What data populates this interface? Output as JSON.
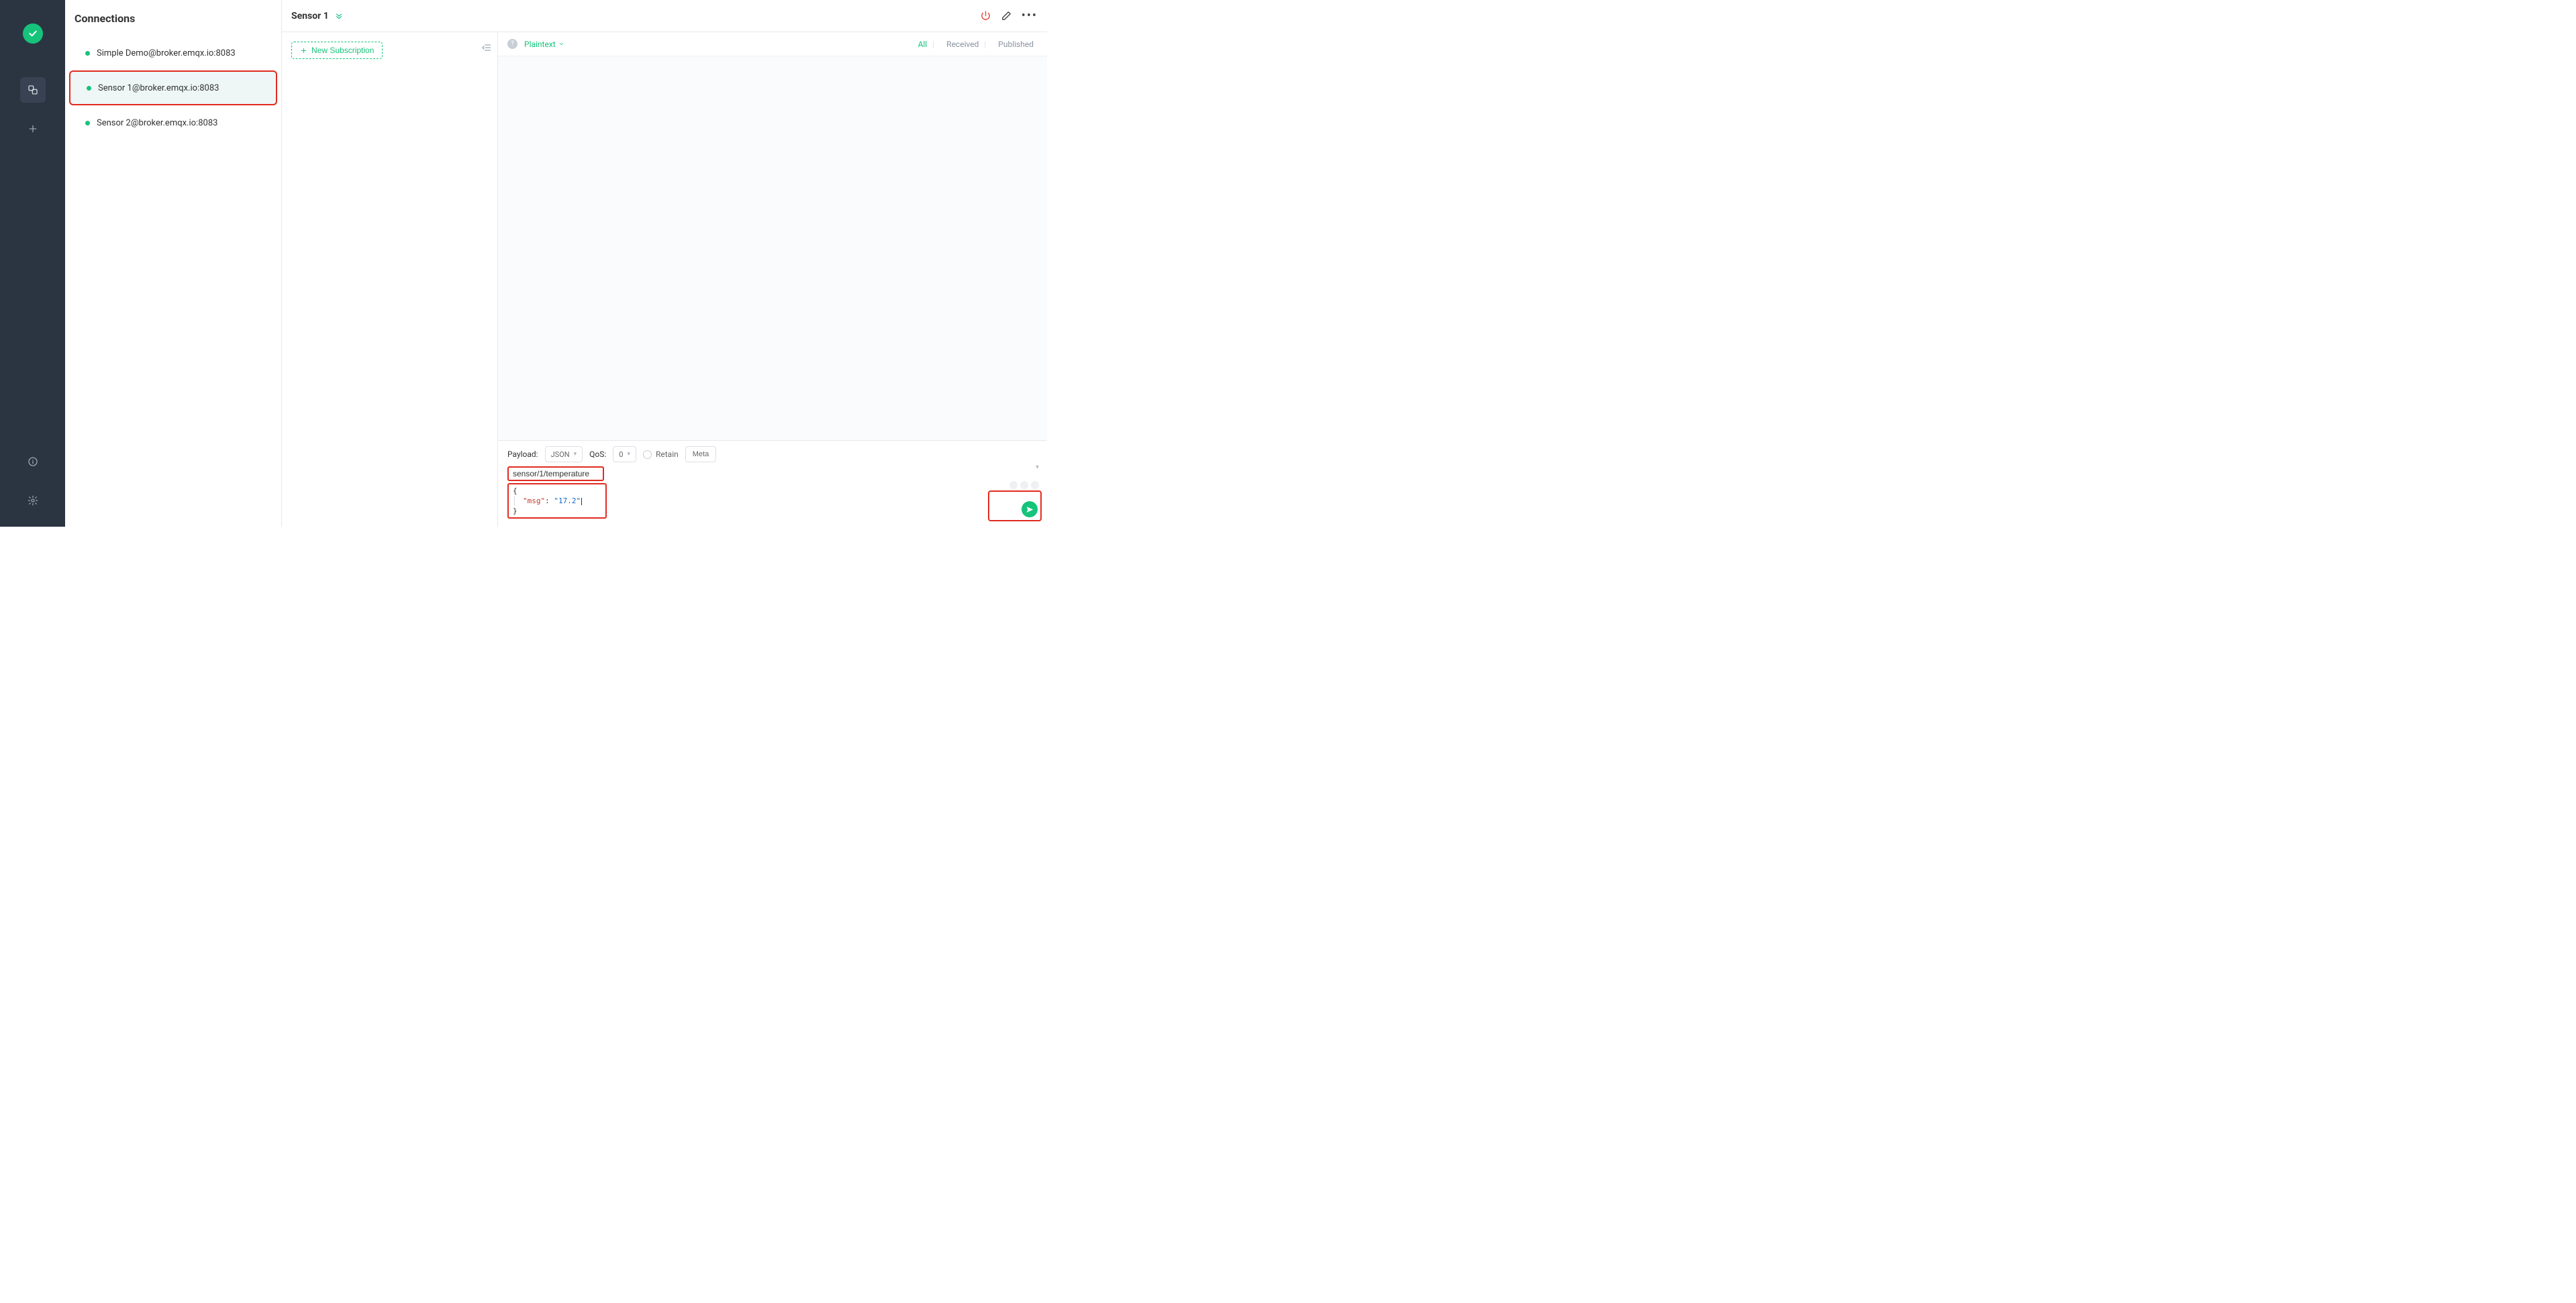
{
  "rail": {
    "items": [
      "connections",
      "add"
    ],
    "bottom": [
      "info",
      "settings"
    ]
  },
  "connections": {
    "title": "Connections",
    "items": [
      {
        "label": "Simple Demo@broker.emqx.io:8083",
        "active": false,
        "highlighted": false
      },
      {
        "label": "Sensor 1@broker.emqx.io:8083",
        "active": true,
        "highlighted": true
      },
      {
        "label": "Sensor 2@broker.emqx.io:8083",
        "active": false,
        "highlighted": false
      }
    ]
  },
  "header": {
    "connection_name": "Sensor 1"
  },
  "subscriptions": {
    "new_button_label": "New Subscription"
  },
  "messages_toolbar": {
    "format_label": "Plaintext",
    "filters": {
      "all": "All",
      "received": "Received",
      "published": "Published"
    },
    "active_filter": "all"
  },
  "payload": {
    "label": "Payload:",
    "format_options_selected": "JSON",
    "qos_label": "QoS:",
    "qos_selected": "0",
    "retain_label": "Retain",
    "meta_label": "Meta",
    "topic_value": "sensor/1/temperature",
    "body_key": "\"msg\"",
    "body_value": "\"17.2\""
  },
  "colors": {
    "accent": "#15c37a",
    "highlight": "#e12b1f"
  }
}
